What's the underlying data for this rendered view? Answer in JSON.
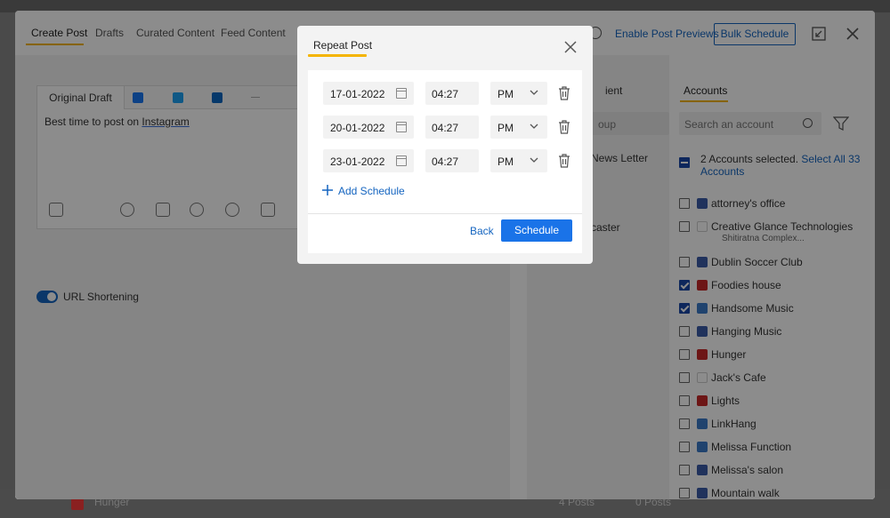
{
  "background": {
    "row_text": "Hunger",
    "row_col2": "4 Posts",
    "row_col3": "0 Posts"
  },
  "tabs": [
    {
      "label": "Create Post"
    },
    {
      "label": "Drafts"
    },
    {
      "label": "Curated Content"
    },
    {
      "label": "Feed Content"
    }
  ],
  "top_actions": {
    "previews_link": "Enable Post Previews",
    "bulk_button": "Bulk Schedule"
  },
  "editor": {
    "tab_label": "Original Draft",
    "text_prefix": "Best time to post on ",
    "text_link": "Instagram"
  },
  "url_shortening": {
    "label": "URL Shortening",
    "enabled": true
  },
  "middle": {
    "label1": "ient",
    "search_text": "oup",
    "label2": "News Letter",
    "label3": "caster"
  },
  "accounts": {
    "title": "Accounts",
    "search_placeholder": "Search an account",
    "selected_text": "2 Accounts selected.",
    "select_all": "Select All 33 Accounts",
    "items": [
      {
        "name": "attorney's office",
        "checked": false,
        "icon": "facebook-icon"
      },
      {
        "name": "Creative Glance Technologies",
        "sub": "Shitiratna Complex...",
        "checked": false,
        "icon": "blank-icon"
      },
      {
        "name": "Dublin Soccer Club",
        "checked": false,
        "icon": "group-icon"
      },
      {
        "name": "Foodies house",
        "checked": true,
        "icon": "pinterest-icon"
      },
      {
        "name": "Handsome Music",
        "checked": true,
        "icon": "business-icon"
      },
      {
        "name": "Hanging Music",
        "checked": false,
        "icon": "facebook-icon"
      },
      {
        "name": "Hunger",
        "checked": false,
        "icon": "pinterest-icon"
      },
      {
        "name": "Jack's Cafe",
        "checked": false,
        "icon": "blank-icon"
      },
      {
        "name": "Lights",
        "checked": false,
        "icon": "pinterest-icon"
      },
      {
        "name": "LinkHang",
        "checked": false,
        "icon": "business-icon"
      },
      {
        "name": "Melissa Function",
        "checked": false,
        "icon": "business-icon"
      },
      {
        "name": "Melissa's salon",
        "checked": false,
        "icon": "facebook-icon"
      },
      {
        "name": "Mountain walk",
        "checked": false,
        "icon": "facebook-icon"
      }
    ]
  },
  "modal": {
    "title": "Repeat Post",
    "schedules": [
      {
        "date": "17-01-2022",
        "time": "04:27",
        "ampm": "PM"
      },
      {
        "date": "20-01-2022",
        "time": "04:27",
        "ampm": "PM"
      },
      {
        "date": "23-01-2022",
        "time": "04:27",
        "ampm": "PM"
      }
    ],
    "add_label": "Add Schedule",
    "back_label": "Back",
    "schedule_label": "Schedule"
  },
  "colors": {
    "accent": "#1a73e8",
    "highlight": "#f4b400",
    "link": "#1565c0"
  }
}
